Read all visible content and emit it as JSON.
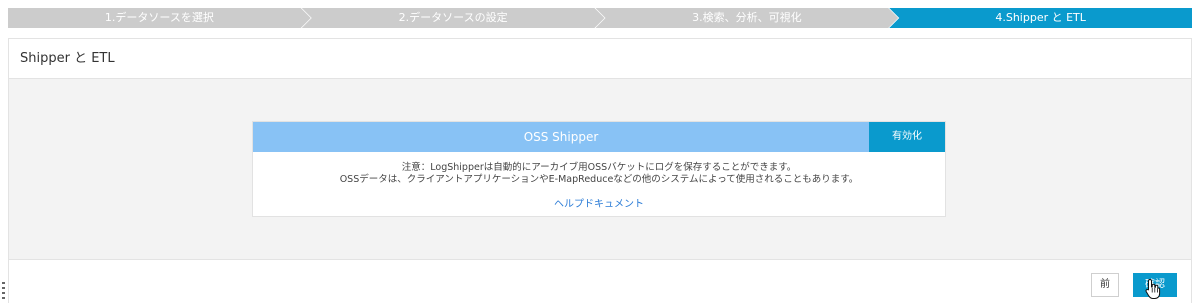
{
  "wizard": {
    "steps": [
      {
        "label": "1.データソースを選択"
      },
      {
        "label": "2.データソースの設定"
      },
      {
        "label": "3.検索、分析、可視化"
      },
      {
        "label": "4.Shipper と ETL"
      }
    ],
    "active_step": 4
  },
  "panel": {
    "title": "Shipper と ETL"
  },
  "shipper_card": {
    "title": "OSS Shipper",
    "enable_label": "有効化",
    "note_line1": "注意：LogShipperは自動的にアーカイブ用OSSバケットにログを保存することができます。",
    "note_line2": "OSSデータは、クライアントアプリケーションやE-MapReduceなどの他のシステムによって使用されることもあります。",
    "help_link": "ヘルプドキュメント"
  },
  "footer": {
    "prev_label": "前",
    "confirm_label": "確認"
  },
  "colors": {
    "accent": "#0a9acd",
    "card_header": "#88c2f5",
    "inactive_step": "#cccccc",
    "link": "#2a7bd6"
  },
  "icons": {
    "cursor": "hand-pointer-icon",
    "grip": "resize-grip-icon"
  }
}
